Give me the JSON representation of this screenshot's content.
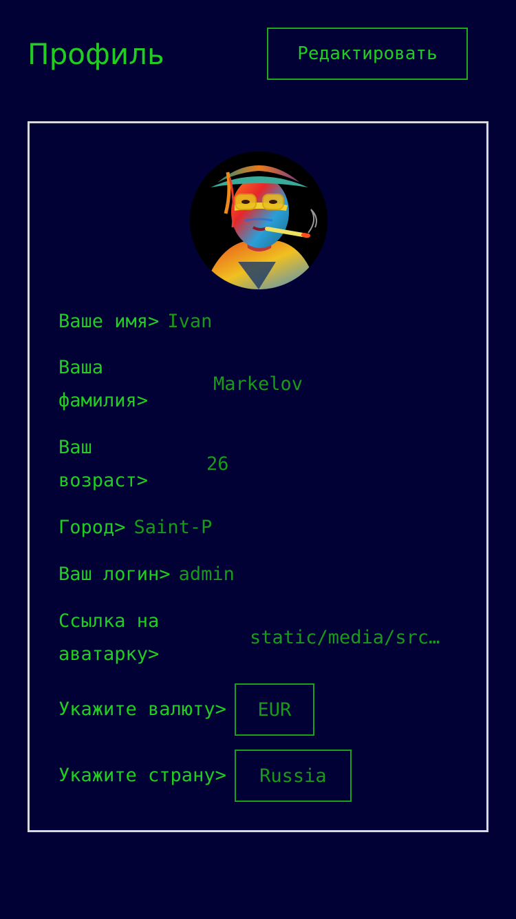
{
  "header": {
    "title": "Профиль",
    "edit_label": "Редактировать"
  },
  "profile": {
    "name_label": "Ваше имя>",
    "name_value": "Ivan",
    "surname_label": "Ваша фамилия>",
    "surname_value": "Markelov",
    "age_label": "Ваш возраст>",
    "age_value": "26",
    "city_label": "Город>",
    "city_value": "Saint-P",
    "login_label": "Ваш логин>",
    "login_value": "admin",
    "avatar_link_label": "Ссылка на аватарку>",
    "avatar_link_value": "static/media/src…",
    "currency_label": "Укажите валюту>",
    "currency_value": "EUR",
    "country_label": "Укажите страну>",
    "country_value": "Russia"
  },
  "colors": {
    "background": "#010135",
    "accent": "#22cc22",
    "value_text": "#1a9a1a",
    "card_border": "#d8d8e0"
  }
}
